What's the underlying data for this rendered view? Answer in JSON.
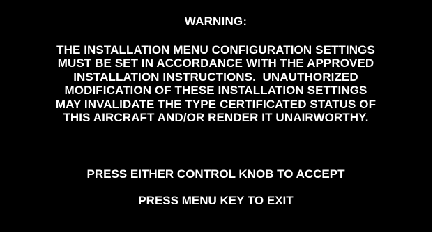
{
  "screen": {
    "title": "WARNING:",
    "body_lines": [
      "THE INSTALLATION MENU CONFIGURATION SETTINGS",
      "MUST BE SET IN ACCORDANCE WITH THE APPROVED",
      "INSTALLATION INSTRUCTIONS.  UNAUTHORIZED",
      "MODIFICATION OF THESE INSTALLATION SETTINGS",
      "MAY INVALIDATE THE TYPE CERTIFICATED STATUS OF",
      "THIS AIRCRAFT AND/OR RENDER IT UNAIRWORTHY."
    ],
    "accept_prompt": "PRESS EITHER CONTROL KNOB TO ACCEPT",
    "exit_prompt": "PRESS MENU KEY TO EXIT"
  },
  "colors": {
    "background": "#000000",
    "text": "#ffffff"
  }
}
